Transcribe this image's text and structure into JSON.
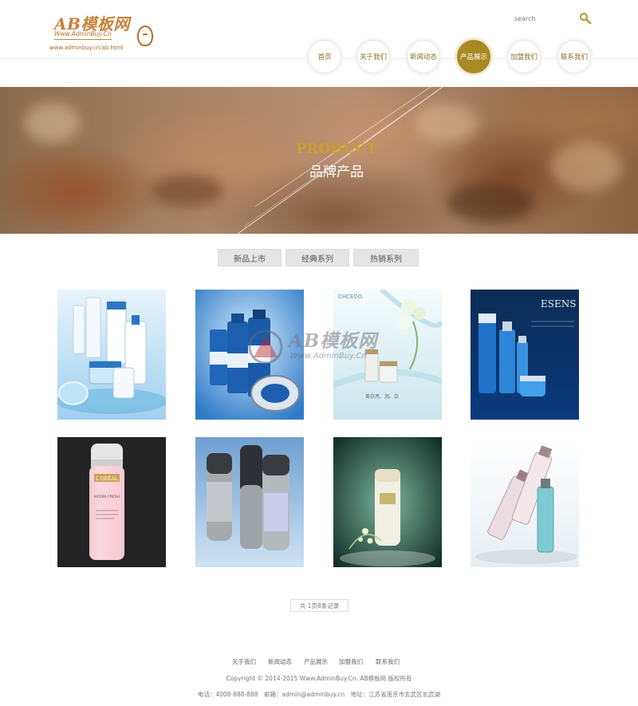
{
  "logo": {
    "main": "AB模板网",
    "sub": "Www.AdminBuy.Cn",
    "url": "www.adminbuy.cn/ab.html"
  },
  "search": {
    "placeholder": "search"
  },
  "nav": {
    "items": [
      {
        "label": "首页"
      },
      {
        "label": "关于我们"
      },
      {
        "label": "新闻动态"
      },
      {
        "label": "产品展示"
      },
      {
        "label": "加盟我们"
      },
      {
        "label": "联系我们"
      }
    ],
    "active_index": 3,
    "accent_color": "#a88a24"
  },
  "banner": {
    "title": "PRODUCT",
    "subtitle": "品牌产品"
  },
  "tabs": [
    {
      "label": "新品上市"
    },
    {
      "label": "经典系列"
    },
    {
      "label": "热销系列"
    }
  ],
  "products": {
    "row1": [
      "product-image-1",
      "product-image-2",
      "product-image-3",
      "product-image-4"
    ],
    "row2": [
      "product-image-5",
      "product-image-6",
      "product-image-7",
      "product-image-8"
    ],
    "texts": {
      "p3_brand": "CHCEDO",
      "p3_caption": "美白亮、润、白",
      "p4_brand": "ESENS",
      "p5_brand": "L'ORÉAL",
      "p5_label": "HYDRA FRESH"
    }
  },
  "watermark": {
    "logo": "AB模板网",
    "sub": "Www.AdminBuy.Cn"
  },
  "pagination": {
    "text": "共 1页8条记录"
  },
  "footer": {
    "links": [
      "关于我们",
      "新闻动态",
      "产品展示",
      "加盟我们",
      "联系我们"
    ],
    "copyright": "Copyright © 2014-2015 Www.AdminBuy.Cn. AB模板网 版权所有",
    "contact": "电话：4008-888-888　邮箱：admin@adminbuy.cn　地址：江苏省南京市玄武区玄武湖"
  }
}
